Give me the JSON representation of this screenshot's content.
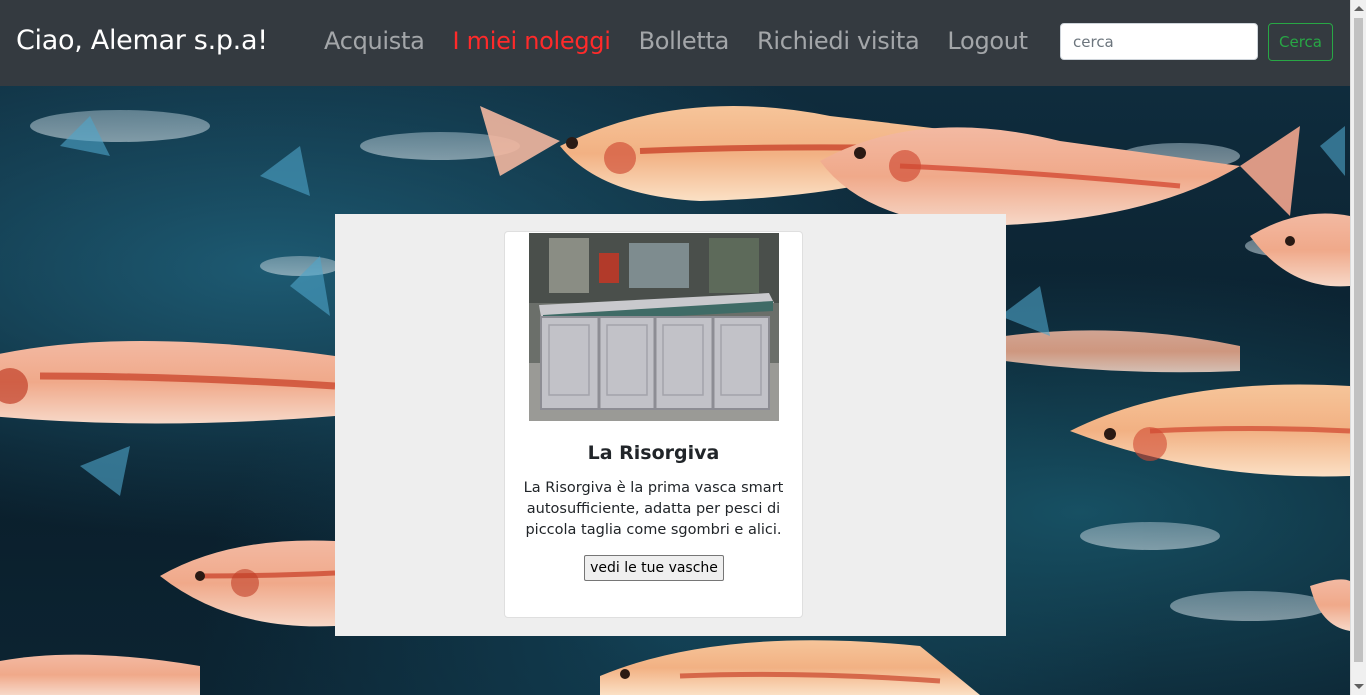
{
  "navbar": {
    "brand": "Ciao, Alemar s.p.a!",
    "links": [
      {
        "label": "Acquista",
        "active": false
      },
      {
        "label": "I miei noleggi",
        "active": true
      },
      {
        "label": "Bolletta",
        "active": false
      },
      {
        "label": "Richiedi visita",
        "active": false
      },
      {
        "label": "Logout",
        "active": false
      }
    ],
    "search": {
      "placeholder": "cerca",
      "value": "",
      "button_label": "Cerca"
    }
  },
  "card": {
    "title": "La Risorgiva",
    "text": "La Risorgiva è la prima vasca smart autosufficiente, adatta per pesci di piccola taglia come sgombri e alici.",
    "button_label": "vedi le tue vasche"
  },
  "colors": {
    "navbar_bg": "#343a40",
    "active_link": "#ff2a2a",
    "search_button": "#28a745",
    "panel_bg": "#eeeeee"
  }
}
